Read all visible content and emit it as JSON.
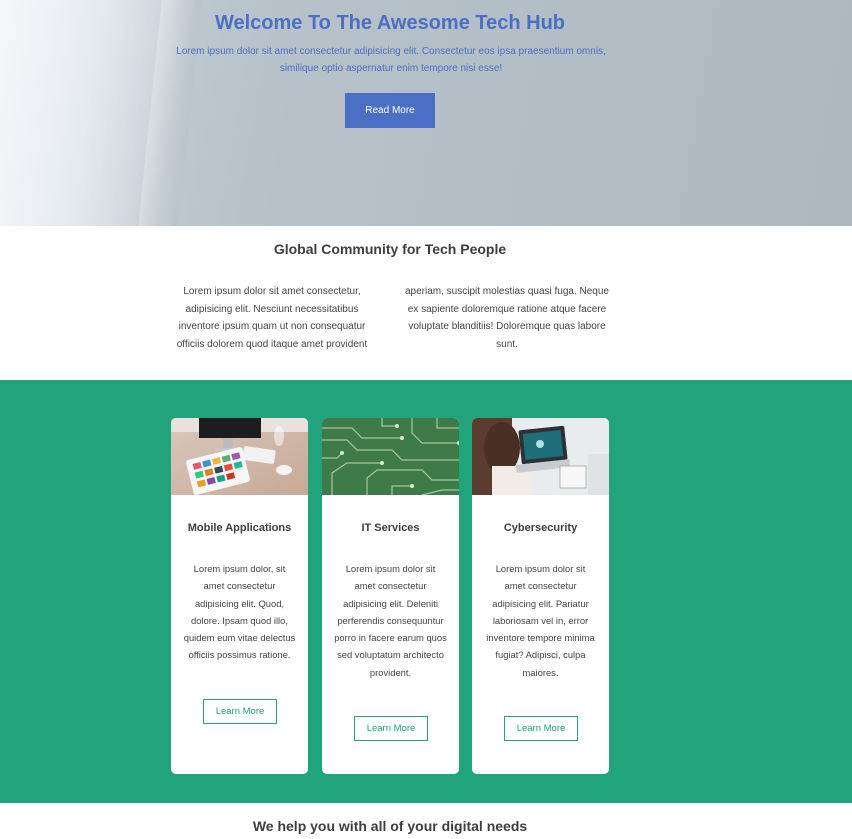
{
  "hero": {
    "title": "Welcome To The Awesome Tech Hub",
    "text": "Lorem ipsum dolor sit amet consectetur adipisicing elit. Consectetur eos ipsa praesentium omnis, similique optio aspernatur enim tempore nisi esse!",
    "button_label": "Read More",
    "accent_color": "#4a6fc4"
  },
  "community": {
    "title": "Global Community for Tech People",
    "col_left": "Lorem ipsum dolor sit amet consectetur, adipisicing elit. Nesciunt necessitatibus inventore ipsum quam ut non consequatur officiis dolorem quod itaque amet provident",
    "col_right": "aperiam, suscipit molestias quasi fuga. Neque ex sapiente doloremque ratione atque facere voluptate blanditiis! Doloremque quas labore sunt."
  },
  "services": {
    "background_color": "#21a47b",
    "cards": [
      {
        "image": "desk-tablet-photo",
        "title": "Mobile Applications",
        "text": "Lorem ipsum dolor, sit amet consectetur adipisicing elit. Quod, dolore. Ipsam quod illo, quidem eum vitae delectus officiis possimus ratione.",
        "button_label": "Learn More"
      },
      {
        "image": "circuit-board-photo",
        "title": "IT Services",
        "text": "Lorem ipsum dolor sit amet consectetur adipisicing elit. Deleniti perferendis consequuntur porro in facere earum quos sed voluptatum architecto provident.",
        "button_label": "Learn More"
      },
      {
        "image": "laptop-security-photo",
        "title": "Cybersecurity",
        "text": "Lorem ipsum dolor sit amet consectetur adipisicing elit. Pariatur laboriosam vel in, error inventore tempore minima fugiat? Adipisci, culpa maiores.",
        "button_label": "Learn More"
      }
    ]
  },
  "needs": {
    "title": "We help you with all of your digital needs"
  }
}
